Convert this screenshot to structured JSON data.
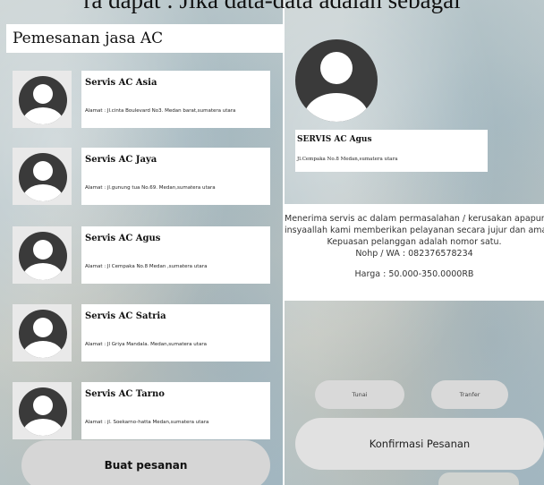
{
  "caption_cut_text": "ra dapat : Jika data-data adalah sebagai",
  "left_screen": {
    "title": "Pemesanan jasa AC",
    "items": [
      {
        "name": "Servis AC Asia",
        "address": "Alamat :  Jl.cinta Boulevard No3. Medan barat,sumatera utara"
      },
      {
        "name": "Servis AC Jaya",
        "address": "Alamat : jl.gunung tua No.69. Medan,sumatera utara"
      },
      {
        "name": "Servis AC Agus",
        "address": "Alamat : Jl Cempaka No.8 Medan ,sumatera utara"
      },
      {
        "name": "Servis AC Satria",
        "address": "Alamat : Jl Griya Mandala. Medan,sumatera utara"
      },
      {
        "name": "Servis AC Tarno",
        "address": "Alamat : jl. Soekarno-hatta Medan,sumatera utara"
      }
    ],
    "button_label": "Buat pesanan"
  },
  "right_screen": {
    "name": "SERVIS AC Agus",
    "address": "Jl.Cempaka No.8 Medan,sumatera utara",
    "desc_lines": [
      "Menerima servis ac dalam permasalahan / kerusakan  apapun.",
      "insyaallah kami memberikan pelayanan secara jujur dan amanah",
      "Kepuasan pelanggan adalah nomor satu.",
      "Nohp / WA : 082376578234"
    ],
    "price": "Harga : 50.000-350.0000RB",
    "payment_options": [
      "Tunai",
      "Tranfer"
    ],
    "confirm_label": "Konfirmasi Pesanan"
  }
}
